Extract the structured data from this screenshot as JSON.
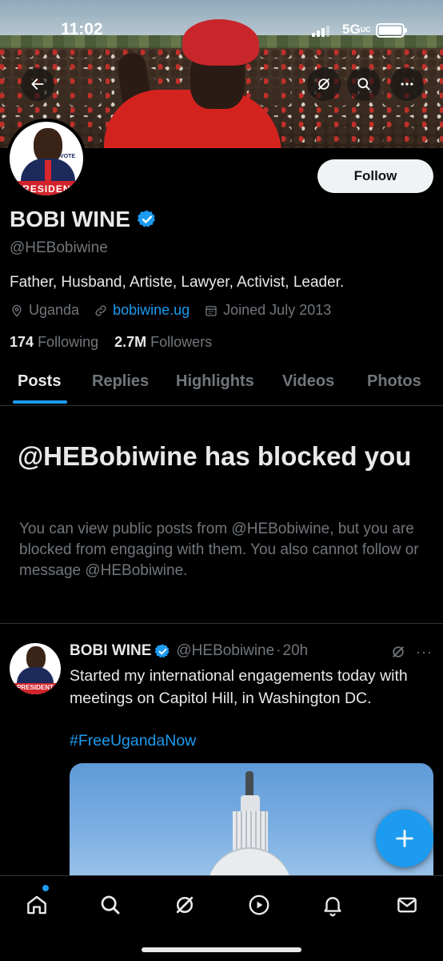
{
  "status_bar": {
    "time": "11:02",
    "network": "5G",
    "network_suffix": "UC"
  },
  "profile": {
    "name": "BOBI WINE",
    "verified": true,
    "handle": "@HEBobiwine",
    "bio": "Father, Husband, Artiste, Lawyer, Activist, Leader.",
    "location": "Uganda",
    "website": "bobiwine.ug",
    "joined": "Joined July 2013",
    "following_count": "174",
    "following_label": "Following",
    "followers_count": "2.7M",
    "followers_label": "Followers",
    "follow_button": "Follow",
    "avatar_banner_text": "PRESIDENT",
    "avatar_vote_text": "VOTE"
  },
  "tabs": [
    {
      "label": "Posts",
      "active": true
    },
    {
      "label": "Replies",
      "active": false
    },
    {
      "label": "Highlights",
      "active": false
    },
    {
      "label": "Videos",
      "active": false
    },
    {
      "label": "Photos",
      "active": false
    }
  ],
  "blocked": {
    "title": "@HEBobiwine has blocked you",
    "description": "You can view public posts from @HEBobiwine, but you are blocked from engaging with them. You also cannot follow or message @HEBobiwine."
  },
  "post": {
    "author_name": "BOBI WINE",
    "author_handle": "@HEBobiwine",
    "separator": "·",
    "time": "20h",
    "text": "Started my international engagements today with meetings on Capitol Hill, in Washington DC.",
    "hashtag": "#FreeUgandaNow",
    "more": "···"
  },
  "header_buttons": [
    "back-arrow-icon",
    "grok-icon",
    "search-icon",
    "more-icon"
  ],
  "bottom_nav": [
    "home-icon",
    "search-icon",
    "grok-icon",
    "play-icon",
    "bell-icon",
    "mail-icon"
  ],
  "colors": {
    "accent": "#1d9bf0",
    "muted": "#71767b",
    "text": "#e7e9ea",
    "background": "#000000"
  }
}
